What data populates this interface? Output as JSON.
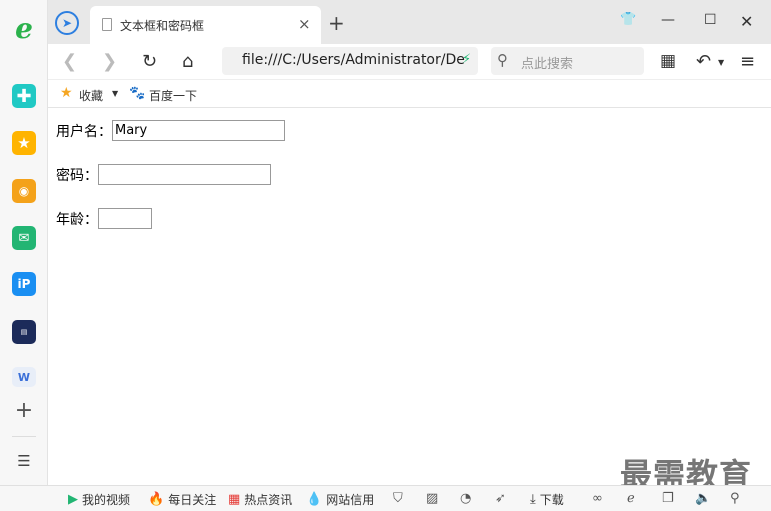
{
  "window": {
    "tab_title": "文本框和密码框",
    "new_tab_symbol": "+",
    "close_tab_symbol": "×"
  },
  "navbar": {
    "address": "file:///C:/Users/Administrator/De",
    "search_placeholder": "点此搜索"
  },
  "bookmarks": {
    "favorites_label": "收藏",
    "baidu_label": "百度一下"
  },
  "form": {
    "username_label": "用户名：",
    "username_value": "Mary",
    "password_label": "密码：",
    "password_value": "",
    "age_label": "年龄：",
    "age_value": ""
  },
  "watermark": "最需教育",
  "statusbar": {
    "my_video": "我的视频",
    "daily_focus": "每日关注",
    "hot_news": "热点资讯",
    "site_credit": "网站信用",
    "download": "下载"
  },
  "icons": {
    "browser_logo": "navigation-arrow-icon",
    "sidebar": [
      "ie-icon",
      "plus-cross-icon",
      "star-icon",
      "weibo-icon",
      "mail-icon",
      "ip-icon",
      "news-icon",
      "word-doc-icon"
    ]
  },
  "colors": {
    "accent_blue": "#2d7fe0",
    "green": "#22b573",
    "star_orange": "#f5a623"
  }
}
